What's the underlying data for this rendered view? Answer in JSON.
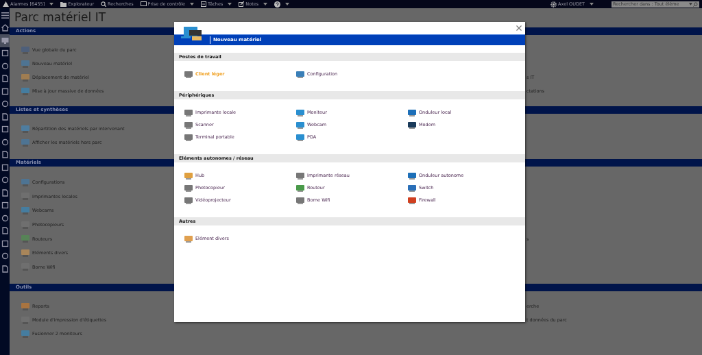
{
  "top_bar": {
    "menus": [
      {
        "kind": "alarm",
        "label": "Alarmes [6455]",
        "dropdown": true
      },
      {
        "kind": "folder",
        "label": "Explorateur",
        "dropdown": false
      },
      {
        "kind": "search",
        "label": "Recherches",
        "dropdown": false
      },
      {
        "kind": "remote",
        "label": "Prise de contrôle",
        "dropdown": true
      },
      {
        "kind": "tasks",
        "label": "Tâches",
        "dropdown": true
      },
      {
        "kind": "notes",
        "label": "Notes",
        "dropdown": true
      },
      {
        "kind": "help",
        "dropdown": true
      }
    ],
    "user": "Axel OUDET",
    "search": {
      "placeholder": "Rechercher dans : Tout éléme"
    }
  },
  "rail_items": [
    {
      "selected": false
    },
    {
      "selected": false
    },
    {
      "selected": true
    },
    {
      "selected": false
    },
    {
      "selected": false
    },
    {
      "selected": false
    },
    {
      "selected": false
    },
    {
      "selected": false
    },
    {
      "selected": false
    },
    {
      "selected": false
    },
    {
      "selected": false
    },
    {
      "selected": false
    },
    {
      "selected": false
    },
    {
      "selected": false
    },
    {
      "selected": false
    },
    {
      "selected": false
    },
    {
      "selected": false
    },
    {
      "selected": false
    },
    {
      "selected": false
    },
    {
      "selected": false
    },
    {
      "selected": false
    }
  ],
  "page": {
    "title": "Parc matériel IT",
    "sections": [
      {
        "title": "Actions",
        "rows": [
          {
            "label": "Vue globale du parc"
          },
          {
            "label": "Nouveau matériel"
          },
          {
            "label": "Déplacement de matériel",
            "right": "s IT"
          },
          {
            "label": "Mise à jour massive de données",
            "right": "ctations"
          }
        ]
      },
      {
        "title": "Listes et synthèses",
        "rows": [
          {
            "label": "Répartition des matériels par intervenant"
          },
          {
            "label": "Afficher les matériels hors parc"
          }
        ]
      },
      {
        "title": "Matériels",
        "rows": [
          {
            "label": "Configurations"
          },
          {
            "label": "Imprimantes locales"
          },
          {
            "label": "Webcams"
          },
          {
            "label": "Photocopieurs"
          },
          {
            "label": "Routeurs",
            "right": "s"
          },
          {
            "label": "Eléments divers"
          },
          {
            "label": "Borne Wifi"
          }
        ]
      },
      {
        "title": "Outils",
        "rows": [
          {
            "label": "Reports",
            "right": "erche"
          },
          {
            "label": "Module d'impression d'étiquettes",
            "right": "t données du parc"
          },
          {
            "label": "Fusionner 2 moniteurs"
          }
        ]
      }
    ]
  },
  "modal": {
    "title": "Nouveau matériel",
    "sections": [
      {
        "title": "Postes de travail",
        "items": [
          {
            "label": "Client léger",
            "selected": true
          },
          {
            "label": "Configuration",
            "selected": false
          }
        ]
      },
      {
        "title": "Périphériques",
        "items": [
          {
            "label": "Imprimante locale",
            "selected": false
          },
          {
            "label": "Moniteur",
            "selected": false
          },
          {
            "label": "Onduleur local",
            "selected": false
          },
          {
            "label": "Scanner",
            "selected": false
          },
          {
            "label": "Webcam",
            "selected": false
          },
          {
            "label": "Modem",
            "selected": false
          },
          {
            "label": "Terminal portable",
            "selected": false
          },
          {
            "label": "PDA",
            "selected": false
          }
        ]
      },
      {
        "title": "Eléments autonomes / réseau",
        "items": [
          {
            "label": "Hub",
            "selected": false
          },
          {
            "label": "Imprimante réseau",
            "selected": false
          },
          {
            "label": "Onduleur autonome",
            "selected": false
          },
          {
            "label": "Photocopieur",
            "selected": false
          },
          {
            "label": "Routeur",
            "selected": false
          },
          {
            "label": "Switch",
            "selected": false
          },
          {
            "label": "Vidéoprojecteur",
            "selected": false
          },
          {
            "label": "Borne Wifi",
            "selected": false
          },
          {
            "label": "Firewall",
            "selected": false
          }
        ]
      },
      {
        "title": "Autres",
        "items": [
          {
            "label": "Elément divers",
            "selected": false
          }
        ]
      }
    ]
  }
}
